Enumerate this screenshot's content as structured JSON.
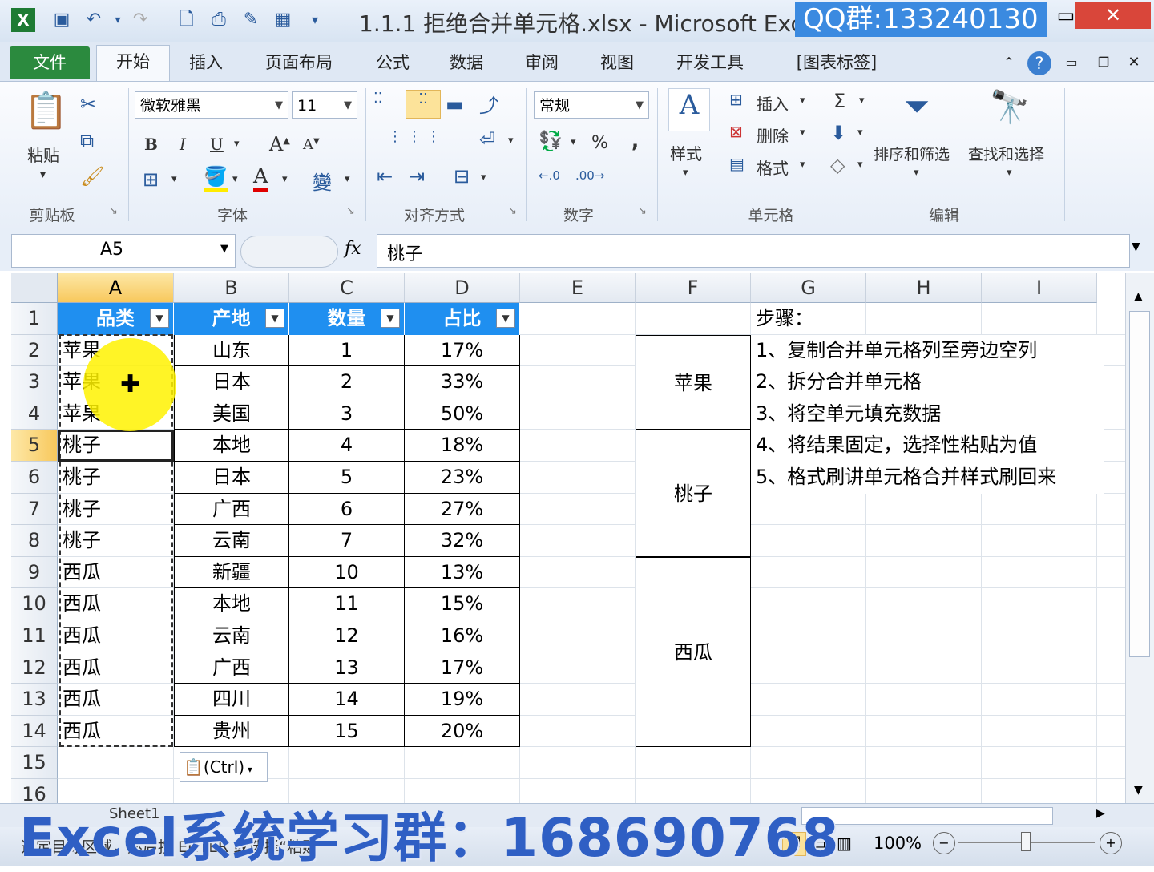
{
  "titlebar": {
    "title": "1.1.1 拒绝合并单元格.xlsx - Microsoft Exce",
    "qq_banner": "QQ群:133240130",
    "minimize": "▭",
    "close": "✕"
  },
  "tabs": [
    "文件",
    "开始",
    "插入",
    "页面布局",
    "公式",
    "数据",
    "审阅",
    "视图",
    "开发工具",
    "[图表标签]"
  ],
  "ribbon": {
    "clipboard": {
      "paste": "粘贴",
      "label": "剪贴板"
    },
    "font": {
      "name": "微软雅黑",
      "size": "11",
      "label": "字体",
      "bold": "B",
      "italic": "I",
      "underline": "U",
      "wen": "變"
    },
    "alignment": {
      "label": "对齐方式"
    },
    "number": {
      "format": "常规",
      "label": "数字",
      "percent": "%",
      "comma": ","
    },
    "styles": {
      "label": "样式"
    },
    "cells": {
      "insert": "插入",
      "delete": "删除",
      "format": "格式",
      "label": "单元格"
    },
    "editing": {
      "sum": "Σ",
      "sort": "排序和筛选",
      "find": "查找和选择",
      "label": "编辑"
    }
  },
  "formula_bar": {
    "name_box": "A5",
    "fx": "fx",
    "value": "桃子"
  },
  "columns": [
    "A",
    "B",
    "C",
    "D",
    "E",
    "F",
    "G",
    "H",
    "I"
  ],
  "rows": [
    "1",
    "2",
    "3",
    "4",
    "5",
    "6",
    "7",
    "8",
    "9",
    "10",
    "11",
    "12",
    "13",
    "14",
    "15",
    "16"
  ],
  "table": {
    "headers": [
      "品类",
      "产地",
      "数量",
      "占比"
    ],
    "data": [
      [
        "苹果",
        "山东",
        "1",
        "17%"
      ],
      [
        "苹果",
        "日本",
        "2",
        "33%"
      ],
      [
        "苹果",
        "美国",
        "3",
        "50%"
      ],
      [
        "桃子",
        "本地",
        "4",
        "18%"
      ],
      [
        "桃子",
        "日本",
        "5",
        "23%"
      ],
      [
        "桃子",
        "广西",
        "6",
        "27%"
      ],
      [
        "桃子",
        "云南",
        "7",
        "32%"
      ],
      [
        "西瓜",
        "新疆",
        "10",
        "13%"
      ],
      [
        "西瓜",
        "本地",
        "11",
        "15%"
      ],
      [
        "西瓜",
        "云南",
        "12",
        "16%"
      ],
      [
        "西瓜",
        "广西",
        "13",
        "17%"
      ],
      [
        "西瓜",
        "四川",
        "14",
        "19%"
      ],
      [
        "西瓜",
        "贵州",
        "15",
        "20%"
      ]
    ]
  },
  "merged_f": [
    "苹果",
    "桃子",
    "西瓜"
  ],
  "steps": {
    "title": "步骤：",
    "items": [
      "1、复制合并单元格列至旁边空列",
      "2、拆分合并单元格",
      "3、将空单元填充数据",
      "4、将结果固定，选择性粘贴为值",
      "5、格式刷讲单元格合并样式刷回来"
    ]
  },
  "paste_options": "(Ctrl)",
  "sheet_tab": "Sheet1",
  "status": {
    "text": "选定目标区域，然后按 ENTER 或选择“粘贴”",
    "zoom": "100%"
  },
  "watermark": "Excel系统学习群：168690768"
}
